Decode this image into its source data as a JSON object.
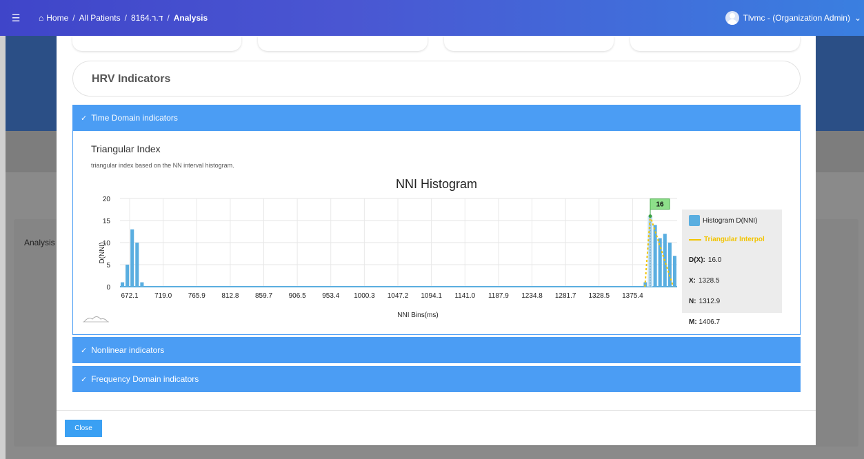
{
  "topbar": {
    "menu_icon": "hamburger-icon",
    "breadcrumb": {
      "home": "Home",
      "sep": "/",
      "all_patients": "All Patients",
      "patient_id": "8164.ד.ר",
      "current": "Analysis"
    },
    "user_label": "Tlvmc - (Organization Admin)"
  },
  "background": {
    "panel_label": "Analysis"
  },
  "modal": {
    "hrv_title": "HRV Indicators",
    "accordion": {
      "time_domain": "Time Domain indicators",
      "nonlinear": "Nonlinear indicators",
      "frequency": "Frequency Domain indicators"
    },
    "section_title": "Triangular Index",
    "section_desc": "triangular index based on the NN interval histogram.",
    "legend": {
      "histogram": "Histogram D(NNI)",
      "interp": "Triangular Interpol",
      "dx_key": "D(X):",
      "dx_val": "16.0",
      "x_key": "X:",
      "x_val": "1328.5",
      "n_key": "N:",
      "n_val": "1312.9",
      "m_key": "M:",
      "m_val": "1406.7"
    },
    "close_label": "Close"
  },
  "colors": {
    "accent": "#4b9df4",
    "bar": "#5aaee0",
    "interp": "#f2c400",
    "marker": "#8ee08a"
  },
  "chart_data": {
    "type": "bar",
    "title": "NNI Histogram",
    "xlabel": "NNI Bins(ms)",
    "ylabel": "D(NNI)",
    "ylim": [
      0,
      20
    ],
    "yticks": [
      0,
      5,
      10,
      15,
      20
    ],
    "xtick_labels": [
      "672.1",
      "719.0",
      "765.9",
      "812.8",
      "859.7",
      "906.5",
      "953.4",
      "1000.3",
      "1047.2",
      "1094.1",
      "1141.0",
      "1187.9",
      "1234.8",
      "1281.7",
      "1328.5",
      "1375.4"
    ],
    "values": [
      1,
      5,
      13,
      10,
      1,
      0,
      0,
      0,
      0,
      0,
      0,
      0,
      0,
      0,
      0,
      0,
      0,
      0,
      0,
      0,
      0,
      0,
      0,
      0,
      0,
      0,
      0,
      0,
      0,
      0,
      0,
      0,
      0,
      0,
      0,
      0,
      0,
      0,
      0,
      0,
      0,
      0,
      0,
      0,
      0,
      0,
      0,
      0,
      0,
      0,
      0,
      0,
      0,
      0,
      0,
      0,
      0,
      0,
      0,
      0,
      0,
      0,
      0,
      0,
      0,
      0,
      0,
      0,
      0,
      0,
      0,
      0,
      0,
      0,
      0,
      0,
      0,
      0,
      0,
      0,
      0,
      0,
      0,
      0,
      0,
      0,
      0,
      0,
      0,
      0,
      0,
      0,
      0,
      0,
      0,
      0,
      0,
      0,
      0,
      0,
      0,
      0,
      0,
      0,
      0,
      0,
      0,
      1,
      16,
      14,
      11,
      12,
      10,
      7
    ],
    "peak_marker": {
      "x": "1328.5",
      "y": 16,
      "label": "16"
    },
    "triangular_interpolation": {
      "N": 1312.9,
      "X": 1328.5,
      "M": 1406.7,
      "D": 16.0
    },
    "series": [
      {
        "name": "Histogram D(NNI)"
      },
      {
        "name": "Triangular Interpol"
      }
    ],
    "grid": true,
    "legend_position": "right"
  }
}
